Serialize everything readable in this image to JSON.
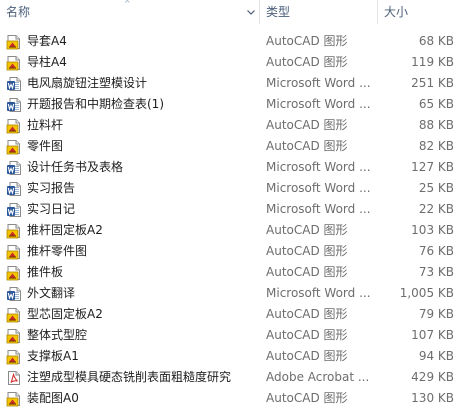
{
  "header": {
    "name_label": "名称",
    "type_label": "类型",
    "size_label": "大小",
    "sort_arrow": "^"
  },
  "files": [
    {
      "name": "导套A4",
      "type": "AutoCAD 图形",
      "size": "68 KB",
      "icon": "autocad-drawing-icon"
    },
    {
      "name": "导柱A4",
      "type": "AutoCAD 图形",
      "size": "119 KB",
      "icon": "autocad-drawing-icon"
    },
    {
      "name": "电风扇旋钮注塑模设计",
      "type": "Microsoft Word ...",
      "size": "251 KB",
      "icon": "word-document-icon"
    },
    {
      "name": "开题报告和中期检查表(1)",
      "type": "Microsoft Word ...",
      "size": "65 KB",
      "icon": "word-document-icon"
    },
    {
      "name": "拉料杆",
      "type": "AutoCAD 图形",
      "size": "88 KB",
      "icon": "autocad-drawing-icon"
    },
    {
      "name": "零件图",
      "type": "AutoCAD 图形",
      "size": "82 KB",
      "icon": "autocad-drawing-icon"
    },
    {
      "name": "设计任务书及表格",
      "type": "Microsoft Word ...",
      "size": "127 KB",
      "icon": "word-document-icon"
    },
    {
      "name": "实习报告",
      "type": "Microsoft Word ...",
      "size": "25 KB",
      "icon": "word-document-icon"
    },
    {
      "name": "实习日记",
      "type": "Microsoft Word ...",
      "size": "22 KB",
      "icon": "word-document-icon"
    },
    {
      "name": "推杆固定板A2",
      "type": "AutoCAD 图形",
      "size": "103 KB",
      "icon": "autocad-drawing-icon"
    },
    {
      "name": "推杆零件图",
      "type": "AutoCAD 图形",
      "size": "76 KB",
      "icon": "autocad-drawing-icon"
    },
    {
      "name": "推件板",
      "type": "AutoCAD 图形",
      "size": "73 KB",
      "icon": "autocad-drawing-icon"
    },
    {
      "name": "外文翻译",
      "type": "Microsoft Word ...",
      "size": "1,005 KB",
      "icon": "word-document-icon"
    },
    {
      "name": "型芯固定板A2",
      "type": "AutoCAD 图形",
      "size": "79 KB",
      "icon": "autocad-drawing-icon"
    },
    {
      "name": "整体式型腔",
      "type": "AutoCAD 图形",
      "size": "107 KB",
      "icon": "autocad-drawing-icon"
    },
    {
      "name": "支撑板A1",
      "type": "AutoCAD 图形",
      "size": "94 KB",
      "icon": "autocad-drawing-icon"
    },
    {
      "name": "注塑成型模具硬态铣削表面粗糙度研究",
      "type": "Adobe Acrobat ...",
      "size": "429 KB",
      "icon": "pdf-document-icon"
    },
    {
      "name": "装配图A0",
      "type": "AutoCAD 图形",
      "size": "130 KB",
      "icon": "autocad-drawing-icon"
    }
  ]
}
